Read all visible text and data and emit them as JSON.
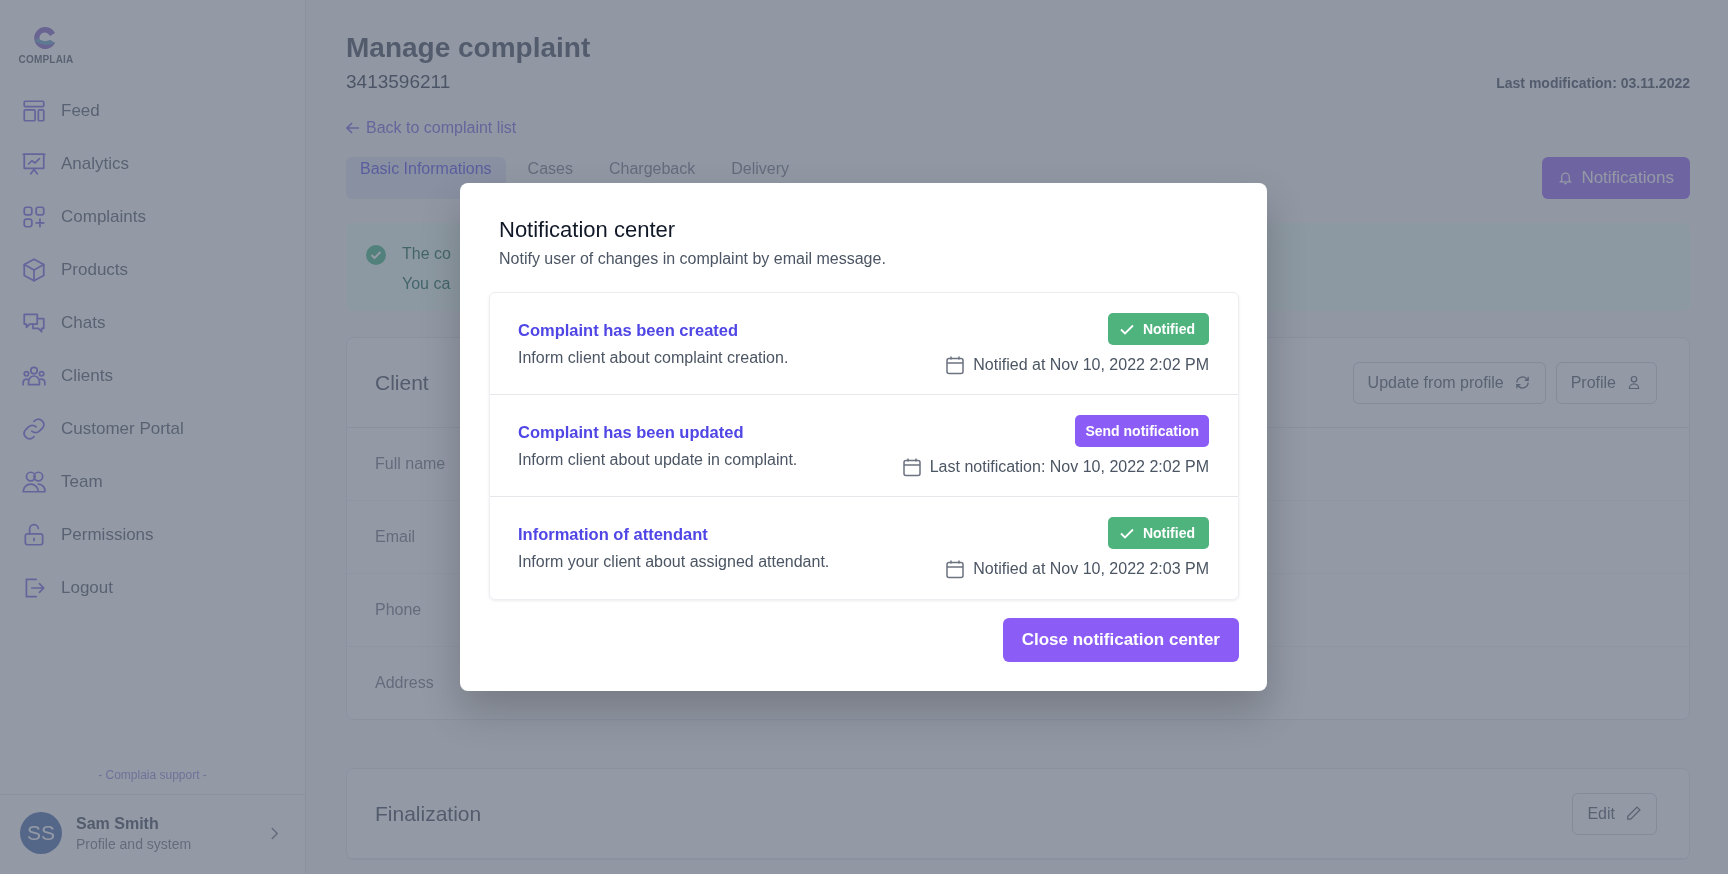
{
  "sidebar": {
    "logo_text": "COMPLAIA",
    "items": [
      {
        "label": "Feed"
      },
      {
        "label": "Analytics"
      },
      {
        "label": "Complaints"
      },
      {
        "label": "Products"
      },
      {
        "label": "Chats"
      },
      {
        "label": "Clients"
      },
      {
        "label": "Customer Portal"
      },
      {
        "label": "Team"
      },
      {
        "label": "Permissions"
      },
      {
        "label": "Logout"
      }
    ],
    "support": "- Complaia support -",
    "user": {
      "initials": "SS",
      "name": "Sam Smith",
      "subtitle": "Profile and system"
    }
  },
  "header": {
    "title": "Manage complaint",
    "number": "3413596211",
    "last_modification": "Last modification: 03.11.2022",
    "back_link": "Back to complaint list"
  },
  "tabs": [
    {
      "label": "Basic Informations",
      "selected": true
    },
    {
      "label": "Cases",
      "selected": false
    },
    {
      "label": "Chargeback",
      "selected": false
    },
    {
      "label": "Delivery",
      "selected": false
    }
  ],
  "notifications_button": "Notifications",
  "alert": {
    "lines": [
      "The co",
      "You ca"
    ]
  },
  "client": {
    "title": "Client",
    "buttons": [
      "Update from profile",
      "Profile"
    ],
    "fields": [
      "Full name",
      "Email",
      "Phone",
      "Address"
    ]
  },
  "finalization": {
    "title": "Finalization",
    "edit_button": "Edit"
  },
  "modal": {
    "title": "Notification center",
    "subtitle": "Notify user of changes in complaint by email message.",
    "items": [
      {
        "title": "Complaint has been created",
        "description": "Inform client about complaint creation.",
        "kind": "notified",
        "status": "Notified",
        "date": "Notified at Nov 10, 2022 2:02 PM"
      },
      {
        "title": "Complaint has been updated",
        "description": "Inform client about update in complaint.",
        "kind": "action",
        "status": "Send notification",
        "date": "Last notification: Nov 10, 2022 2:02 PM"
      },
      {
        "title": "Information of attendant",
        "description": "Inform your client about assigned attendant.",
        "kind": "notified",
        "status": "Notified",
        "date": "Notified at Nov 10, 2022 2:03 PM"
      }
    ],
    "close_button": "Close notification center"
  }
}
